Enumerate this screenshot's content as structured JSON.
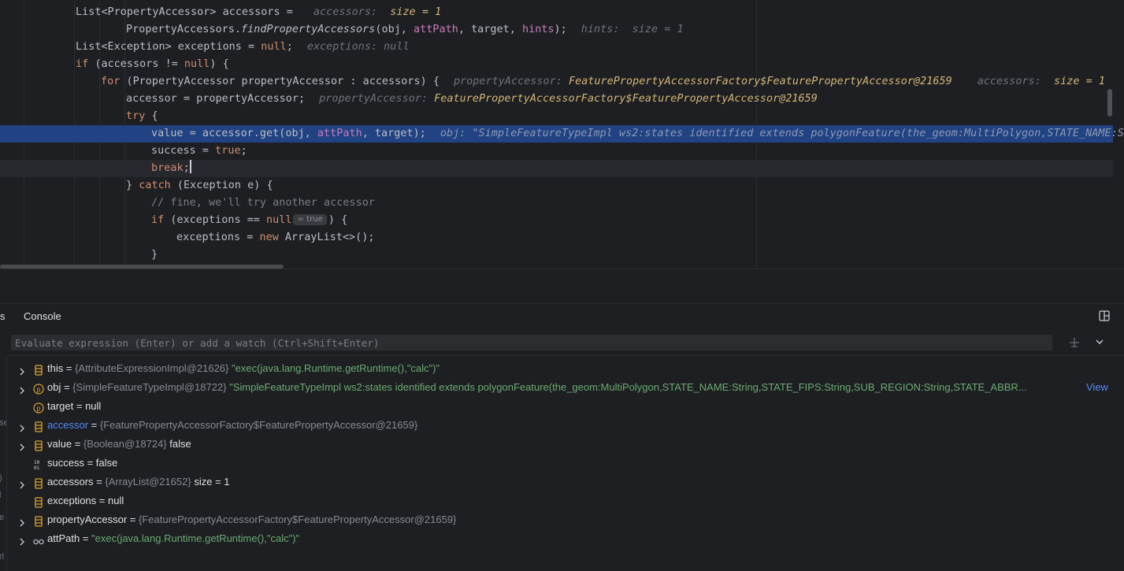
{
  "editor": {
    "lines": [
      {
        "code": "List<PropertyAccessor> accessors = ",
        "hint": "accessors:",
        "hint_value": "size = 1"
      },
      {
        "code_pre": "PropertyAccessors.",
        "code_method": "findPropertyAccessors",
        "code_a": "(obj, ",
        "code_b": "attPath",
        "code_c": ", target, ",
        "code_d": "hints",
        "code_e": ");",
        "hint": "hints:",
        "hint_value": "size = 1"
      },
      {
        "code_a": "List<Exception> exceptions = ",
        "code_b": "null",
        "code_c": ";",
        "hint": "exceptions: null"
      },
      {
        "code_a": "if",
        "code_b": " (accessors != ",
        "code_c": "null",
        "code_d": ") {"
      },
      {
        "code_a": "for",
        "code_b": " (PropertyAccessor propertyAccessor : accessors) {",
        "hint": "propertyAccessor:",
        "hint_value": "FeaturePropertyAccessorFactory$FeaturePropertyAccessor@21659",
        "hint2": "accessors:",
        "hint2_value": "size = 1"
      },
      {
        "code": "accessor = propertyAccessor;",
        "hint": "propertyAccessor:",
        "hint_value": "FeaturePropertyAccessorFactory$FeaturePropertyAccessor@21659"
      },
      {
        "code_a": "try",
        "code_b": " {"
      },
      {
        "code_a": "value = accessor.get(obj, ",
        "code_b": "attPath",
        "code_c": ", target);",
        "hint": "obj: \"SimpleFeatureTypeImpl ws2:states identified extends polygonFeature(the_geom:MultiPolygon,STATE_NAME:S"
      },
      {
        "code_a": "success = ",
        "code_b": "true",
        "code_c": ";"
      },
      {
        "code_a": "break",
        "code_b": ";"
      },
      {
        "code_a": "} ",
        "code_b": "catch",
        "code_c": " (Exception e) {"
      },
      {
        "comment": "// fine, we'll try another accessor"
      },
      {
        "code_a": "if",
        "code_b": " (exceptions == ",
        "code_c": "null",
        "badge": "= true",
        "code_d": ") {"
      },
      {
        "code_a": "exceptions = ",
        "code_b": "new",
        "code_c": " ArrayList<>();"
      },
      {
        "code": "}"
      }
    ]
  },
  "debugger": {
    "tab_fragment": "s",
    "tab_console": "Console",
    "watch_placeholder": "Evaluate expression (Enter) or add a watch (Ctrl+Shift+Enter)",
    "left_strip": [
      "se",
      ")",
      "l",
      "e",
      "rl"
    ],
    "variables": [
      {
        "name": "this",
        "type": "{AttributeExpressionImpl@21626}",
        "value": "\"exec(java.lang.Runtime.getRuntime(),\"calc\")\"",
        "icon": "field-icon",
        "expandable": true
      },
      {
        "name": "obj",
        "type": "{SimpleFeatureTypeImpl@18722}",
        "value": "\"SimpleFeatureTypeImpl ws2:states identified extends polygonFeature(the_geom:MultiPolygon,STATE_NAME:String,STATE_FIPS:String,SUB_REGION:String,STATE_ABBR...",
        "link": "View",
        "icon": "parameter-icon",
        "expandable": true
      },
      {
        "name": "target",
        "type": "",
        "value": "null",
        "icon": "parameter-icon",
        "expandable": false
      },
      {
        "name": "accessor",
        "type": "{FeaturePropertyAccessorFactory$FeaturePropertyAccessor@21659}",
        "value": "",
        "icon": "field-icon",
        "expandable": true,
        "changed": true
      },
      {
        "name": "value",
        "type": "{Boolean@18724}",
        "value": "false",
        "icon": "field-icon",
        "expandable": true
      },
      {
        "name": "success",
        "type": "",
        "value": "false",
        "icon": "primitive-icon",
        "expandable": false
      },
      {
        "name": "accessors",
        "type": "{ArrayList@21652}",
        "value": "size = 1",
        "icon": "field-icon",
        "expandable": true
      },
      {
        "name": "exceptions",
        "type": "",
        "value": "null",
        "icon": "field-icon",
        "expandable": false
      },
      {
        "name": "propertyAccessor",
        "type": "{FeaturePropertyAccessorFactory$FeaturePropertyAccessor@21659}",
        "value": "",
        "icon": "field-icon",
        "expandable": true
      },
      {
        "name": "attPath",
        "type": "",
        "value": "\"exec(java.lang.Runtime.getRuntime(),\"calc\")\"",
        "icon": "watch-glasses-icon",
        "expandable": true
      }
    ]
  },
  "colors": {
    "background": "#1e1f22",
    "exec_line": "#214283",
    "keyword": "#cf8e6d",
    "field": "#c77dbb",
    "string": "#6aab73",
    "hint_value": "#d5b778",
    "link": "#548af7"
  }
}
